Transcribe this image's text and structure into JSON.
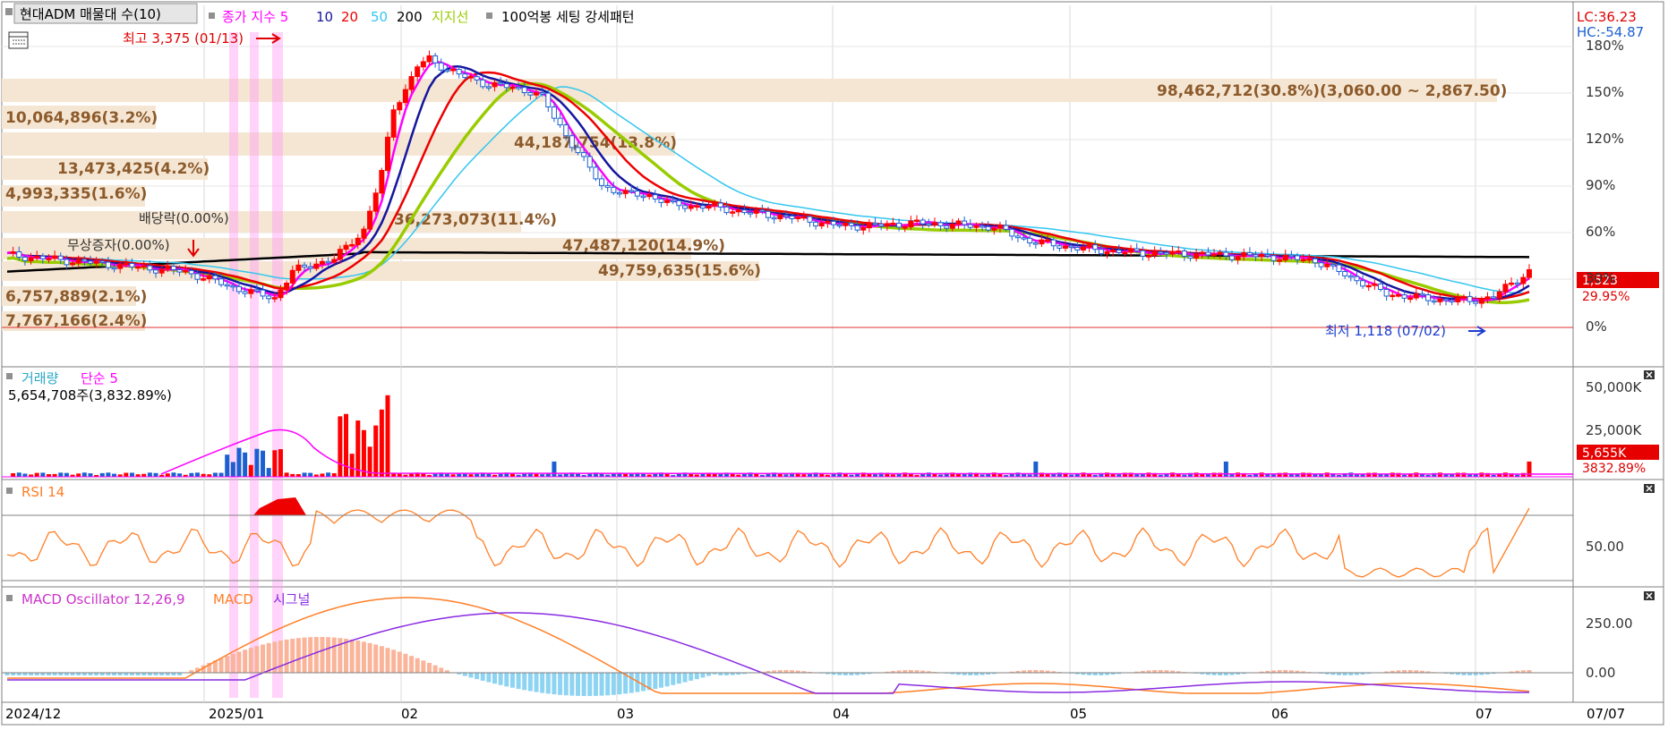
{
  "legend": {
    "title": "현대ADM 매물대 수(10)",
    "ma_label": "종가 지수 5",
    "ma10": "10",
    "ma20": "20",
    "ma50": "50",
    "ma200": "200",
    "support": "지지선",
    "pattern": "100억봉 세팅 강세패턴",
    "lc": "LC:36.23",
    "hc": "HC:-54.87"
  },
  "price_panel": {
    "high_note": "최고 3,375 (01/13)",
    "low_note": "최저 1,118 (07/02)",
    "last_price": "1,523",
    "last_pct": "29.95%",
    "events": [
      "배당락(0.00%)",
      "무상증자(0.00%)"
    ],
    "volume_profile": [
      {
        "label": "98,462,712(30.8%)(3,060.00 ~ 2,867.50)"
      },
      {
        "label": "10,064,896(3.2%)"
      },
      {
        "label": "44,187,754(13.8%)"
      },
      {
        "label": "13,473,425(4.2%)"
      },
      {
        "label": "4,993,335(1.6%)"
      },
      {
        "label": "36,273,073(11.4%)"
      },
      {
        "label": "47,487,120(14.9%)"
      },
      {
        "label": "49,759,635(15.6%)"
      },
      {
        "label": "6,757,889(2.1%)"
      },
      {
        "label": "7,767,166(2.4%)"
      }
    ],
    "y_ticks": [
      "180%",
      "150%",
      "120%",
      "90%",
      "60%",
      "30%",
      "0%"
    ]
  },
  "volume_panel": {
    "label": "거래량",
    "ma_label": "단순 5",
    "info": "5,654,708주(3,832.89%)",
    "last": "5,655K",
    "last_pct": "3832.89%",
    "y_ticks": [
      "50,000K",
      "25,000K"
    ]
  },
  "rsi_panel": {
    "label": "RSI 14",
    "y_tick": "50.00"
  },
  "macd_panel": {
    "label": "MACD Oscillator 12,26,9",
    "macd": "MACD",
    "signal": "시그널",
    "y_ticks": [
      "250.00",
      "0.00"
    ]
  },
  "x_axis": {
    "labels": [
      "2024/12",
      "2025/01",
      "02",
      "03",
      "04",
      "05",
      "06",
      "07"
    ],
    "right": "07/07"
  },
  "colors": {
    "up": "#ff0000",
    "down": "#1c5fd1",
    "ma5": "#ff00ff",
    "ma10": "#1515a0",
    "ma20": "#ee0000",
    "ma50": "#33c6f0",
    "ma200": "#000000",
    "support": "#99cc00",
    "profile": "#f5e6d3",
    "rsi": "#ff7f27",
    "macd": "#ff7f27",
    "signal": "#8a2be2",
    "osc_pos": "#f9b49a",
    "osc_neg": "#8dd3f2"
  },
  "chart_data": {
    "type": "candlestick",
    "approx_close": [
      [
        0,
        1640
      ],
      [
        20,
        1560
      ],
      [
        30,
        1520
      ],
      [
        40,
        1380
      ],
      [
        45,
        1330
      ],
      [
        48,
        1520
      ],
      [
        52,
        1580
      ],
      [
        55,
        1610
      ],
      [
        60,
        1820
      ],
      [
        63,
        2230
      ],
      [
        65,
        2700
      ],
      [
        67,
        2830
      ],
      [
        69,
        3000
      ],
      [
        71,
        3050
      ],
      [
        74,
        2980
      ],
      [
        77,
        2920
      ],
      [
        80,
        2880
      ],
      [
        84,
        2850
      ],
      [
        88,
        2820
      ],
      [
        90,
        2780
      ],
      [
        92,
        2630
      ],
      [
        96,
        2380
      ],
      [
        100,
        2140
      ],
      [
        104,
        2080
      ],
      [
        108,
        2070
      ],
      [
        112,
        2000
      ],
      [
        118,
        1990
      ],
      [
        124,
        1950
      ],
      [
        130,
        1920
      ],
      [
        136,
        1880
      ],
      [
        140,
        1850
      ],
      [
        146,
        1850
      ],
      [
        152,
        1870
      ],
      [
        158,
        1860
      ],
      [
        166,
        1840
      ],
      [
        172,
        1740
      ],
      [
        180,
        1690
      ],
      [
        188,
        1660
      ],
      [
        196,
        1650
      ],
      [
        204,
        1640
      ],
      [
        212,
        1630
      ],
      [
        220,
        1600
      ],
      [
        228,
        1440
      ],
      [
        232,
        1360
      ],
      [
        240,
        1320
      ],
      [
        246,
        1310
      ],
      [
        250,
        1340
      ],
      [
        256,
        1523
      ]
    ],
    "x_range": [
      0,
      256
    ],
    "y_axis": "percent of low",
    "ylim_pct": [
      -5,
      185
    ]
  }
}
